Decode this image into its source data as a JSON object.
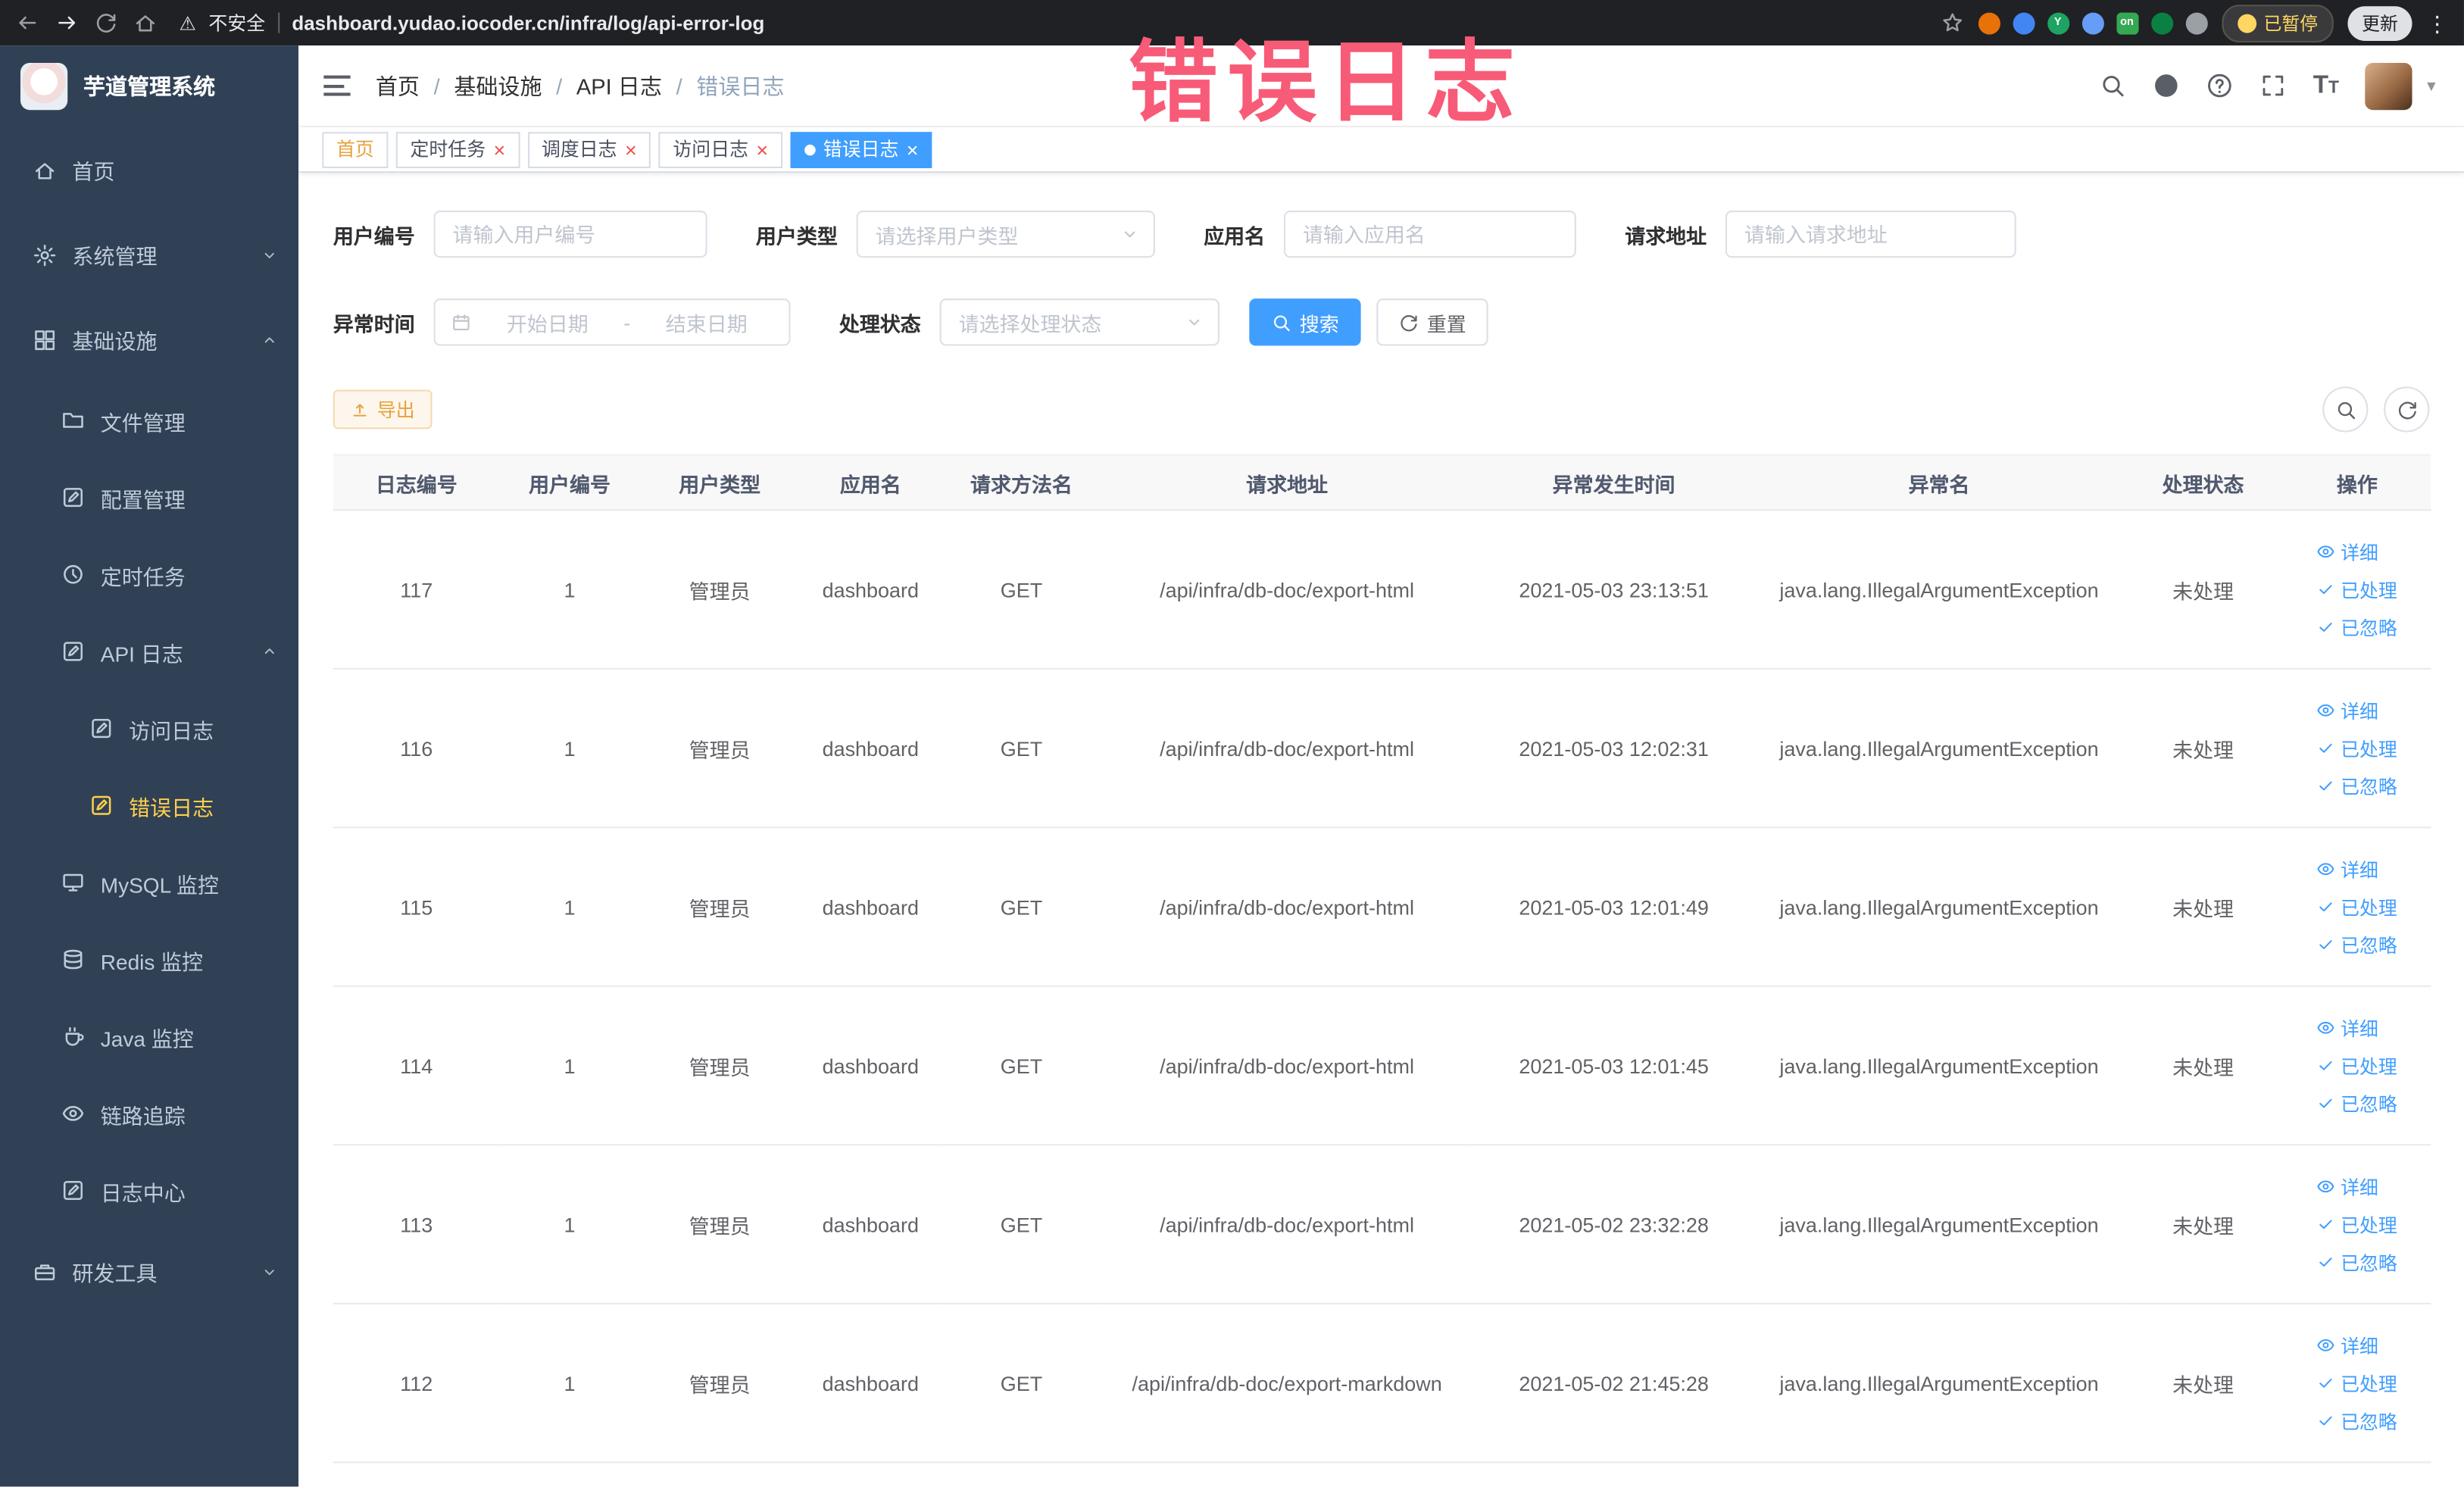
{
  "colors": {
    "accent": "#409eff",
    "sidebar_bg": "#304156",
    "sidebar_text": "#bfcbd9",
    "sidebar_active": "#ffd04b",
    "warning": "#e6a23c",
    "watermark": "#f75b77"
  },
  "icons": {
    "close": "×",
    "kebab": "⋮",
    "caret_down": "▾",
    "warning": "⚠"
  },
  "browser": {
    "security_label": "不安全",
    "url": "dashboard.yudao.iocoder.cn/infra/log/api-error-log",
    "paused_chip": "已暂停",
    "update_chip": "更新",
    "extensions": [
      {
        "color": "#e8710a"
      },
      {
        "color": "#4285f4"
      },
      {
        "color": "#1ea362",
        "label": "Y"
      },
      {
        "color": "#669df6"
      },
      {
        "color": "#34a853",
        "label": "on"
      },
      {
        "color": "#0b8043"
      },
      {
        "color": "#9aa0a6"
      }
    ]
  },
  "sidebar": {
    "logo_title": "芋道管理系统",
    "menu": [
      {
        "key": "home",
        "label": "首页",
        "icon": "home",
        "level": 0
      },
      {
        "key": "system",
        "label": "系统管理",
        "icon": "gear",
        "level": 0,
        "arrow": "down"
      },
      {
        "key": "infra",
        "label": "基础设施",
        "icon": "grid",
        "level": 0,
        "arrow": "up"
      },
      {
        "key": "file",
        "label": "文件管理",
        "icon": "folder",
        "level": 1
      },
      {
        "key": "config",
        "label": "配置管理",
        "icon": "edit-box",
        "level": 1
      },
      {
        "key": "job",
        "label": "定时任务",
        "icon": "clock",
        "level": 1
      },
      {
        "key": "api-log",
        "label": "API 日志",
        "icon": "edit-box",
        "level": 1,
        "arrow": "up"
      },
      {
        "key": "access-log",
        "label": "访问日志",
        "icon": "edit-box",
        "level": 2
      },
      {
        "key": "error-log",
        "label": "错误日志",
        "icon": "edit-box",
        "level": 2,
        "active": true
      },
      {
        "key": "mysql",
        "label": "MySQL 监控",
        "icon": "monitor",
        "level": 1
      },
      {
        "key": "redis",
        "label": "Redis 监控",
        "icon": "database",
        "level": 1
      },
      {
        "key": "java",
        "label": "Java 监控",
        "icon": "coffee",
        "level": 1
      },
      {
        "key": "trace",
        "label": "链路追踪",
        "icon": "eye",
        "level": 1
      },
      {
        "key": "log-center",
        "label": "日志中心",
        "icon": "edit-box",
        "level": 1
      },
      {
        "key": "dev-tools",
        "label": "研发工具",
        "icon": "toolbox",
        "level": 0,
        "arrow": "down"
      }
    ]
  },
  "header": {
    "breadcrumb": [
      "首页",
      "基础设施",
      "API 日志",
      "错误日志"
    ]
  },
  "tabs": [
    {
      "key": "home",
      "label": "首页",
      "closable": false,
      "active": false,
      "affix": true
    },
    {
      "key": "job",
      "label": "定时任务",
      "closable": true,
      "active": false
    },
    {
      "key": "job-log",
      "label": "调度日志",
      "closable": true,
      "active": false
    },
    {
      "key": "access-log",
      "label": "访问日志",
      "closable": true,
      "active": false
    },
    {
      "key": "error-log",
      "label": "错误日志",
      "closable": true,
      "active": true
    }
  ],
  "watermark": "错误日志",
  "filters": {
    "fields": [
      {
        "key": "user_id",
        "row": 1,
        "label": "用户编号",
        "type": "input",
        "placeholder": "请输入用户编号"
      },
      {
        "key": "user_type",
        "row": 1,
        "label": "用户类型",
        "type": "select",
        "placeholder": "请选择用户类型"
      },
      {
        "key": "app_name",
        "row": 1,
        "label": "应用名",
        "type": "input",
        "placeholder": "请输入应用名"
      },
      {
        "key": "request_url",
        "row": 1,
        "label": "请求地址",
        "type": "input",
        "placeholder": "请输入请求地址"
      },
      {
        "key": "error_time",
        "row": 2,
        "label": "异常时间",
        "type": "daterange",
        "start_placeholder": "开始日期",
        "end_placeholder": "结束日期",
        "separator": "-"
      },
      {
        "key": "process_status",
        "row": 2,
        "label": "处理状态",
        "type": "select",
        "placeholder": "请选择处理状态"
      }
    ],
    "search_label": "搜索",
    "reset_label": "重置"
  },
  "toolbar": {
    "export_label": "导出"
  },
  "table": {
    "columns": [
      "日志编号",
      "用户编号",
      "用户类型",
      "应用名",
      "请求方法名",
      "请求地址",
      "异常发生时间",
      "异常名",
      "处理状态",
      "操作"
    ],
    "actions": [
      "详细",
      "已处理",
      "已忽略"
    ],
    "rows": [
      {
        "id": "117",
        "user_id": "1",
        "user_type": "管理员",
        "app": "dashboard",
        "method": "GET",
        "url": "/api/infra/db-doc/export-html",
        "time": "2021-05-03 23:13:51",
        "exception": "java.lang.IllegalArgumentException",
        "status": "未处理"
      },
      {
        "id": "116",
        "user_id": "1",
        "user_type": "管理员",
        "app": "dashboard",
        "method": "GET",
        "url": "/api/infra/db-doc/export-html",
        "time": "2021-05-03 12:02:31",
        "exception": "java.lang.IllegalArgumentException",
        "status": "未处理"
      },
      {
        "id": "115",
        "user_id": "1",
        "user_type": "管理员",
        "app": "dashboard",
        "method": "GET",
        "url": "/api/infra/db-doc/export-html",
        "time": "2021-05-03 12:01:49",
        "exception": "java.lang.IllegalArgumentException",
        "status": "未处理"
      },
      {
        "id": "114",
        "user_id": "1",
        "user_type": "管理员",
        "app": "dashboard",
        "method": "GET",
        "url": "/api/infra/db-doc/export-html",
        "time": "2021-05-03 12:01:45",
        "exception": "java.lang.IllegalArgumentException",
        "status": "未处理"
      },
      {
        "id": "113",
        "user_id": "1",
        "user_type": "管理员",
        "app": "dashboard",
        "method": "GET",
        "url": "/api/infra/db-doc/export-html",
        "time": "2021-05-02 23:32:28",
        "exception": "java.lang.IllegalArgumentException",
        "status": "未处理"
      },
      {
        "id": "112",
        "user_id": "1",
        "user_type": "管理员",
        "app": "dashboard",
        "method": "GET",
        "url": "/api/infra/db-doc/export-markdown",
        "time": "2021-05-02 21:45:28",
        "exception": "java.lang.IllegalArgumentException",
        "status": "未处理"
      }
    ]
  }
}
